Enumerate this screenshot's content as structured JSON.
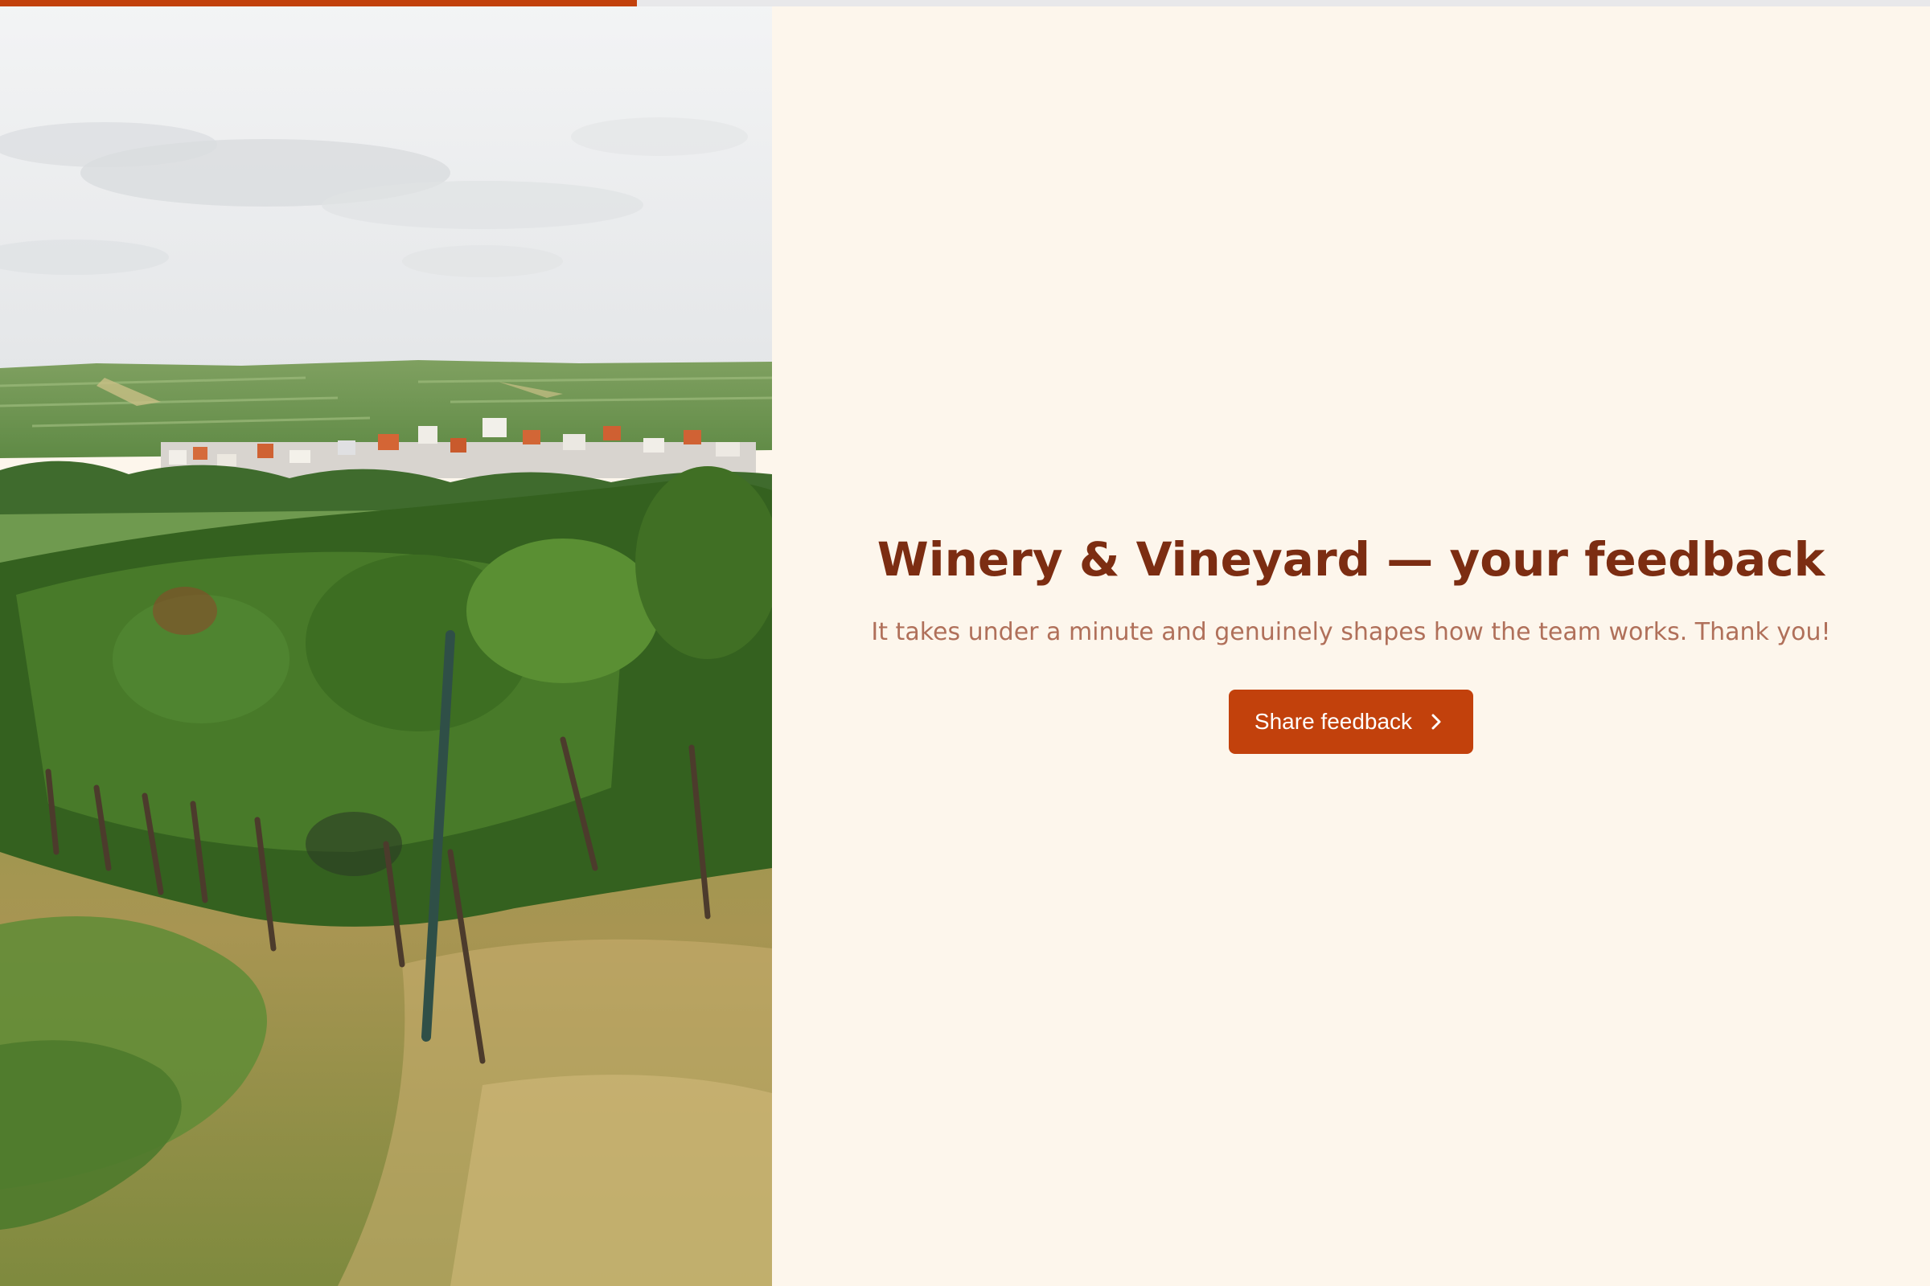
{
  "progress": {
    "fraction": 0.33,
    "color": "#c2410c"
  },
  "hero": {
    "title": "Winery & Vineyard — your feedback",
    "subtitle": "It takes under a minute and genuinely shapes how the team works. Thank you!",
    "cta_label": "Share feedback",
    "cta_icon": "chevron-right-icon"
  },
  "colors": {
    "accent": "#c2410c",
    "title": "#7c2d12",
    "subtitle": "#b0705a",
    "background": "#fdf6ec"
  }
}
